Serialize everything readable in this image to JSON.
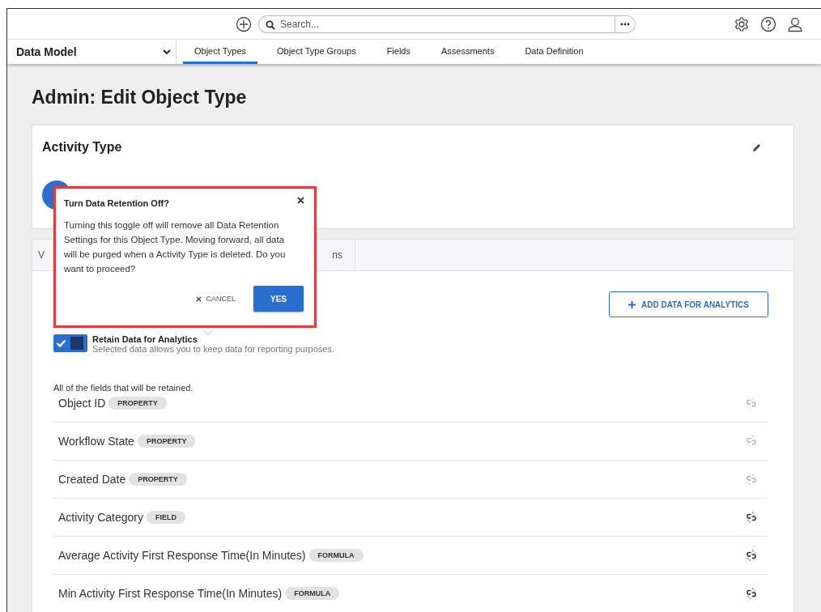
{
  "header": {
    "search": {
      "placeholder": "Search..."
    }
  },
  "nav": {
    "module": "Data Model",
    "tabs": [
      {
        "label": "Object Types",
        "selected": true
      },
      {
        "label": "Object Type Groups",
        "selected": false
      },
      {
        "label": "Fields",
        "selected": false
      },
      {
        "label": "Assessments",
        "selected": false
      },
      {
        "label": "Data Definition",
        "selected": false
      }
    ]
  },
  "page_title": "Admin: Edit Object Type",
  "card": {
    "title": "Activity Type"
  },
  "section_tabs": [
    {
      "label": "V"
    },
    {
      "label": "ns"
    }
  ],
  "popover": {
    "title": "Turn Data Retention Off?",
    "message": "Turning this toggle off will remove all Data Retention Settings for this Object Type. Moving forward, all data will be purged when a Activity Type is deleted. Do you want to proceed?",
    "cancel": "CANCEL",
    "confirm": "YES"
  },
  "add_button": "ADD DATA FOR ANALYTICS",
  "retention": {
    "on": true,
    "label": "Retain Data for Analytics",
    "description": "Selected data allows you to keep data for reporting purposes."
  },
  "fields_caption": "All of the fields that will be retained.",
  "fields": [
    {
      "name": "Object ID",
      "tag": "PROPERTY",
      "disabled": true
    },
    {
      "name": "Workflow State",
      "tag": "PROPERTY",
      "disabled": true
    },
    {
      "name": "Created Date",
      "tag": "PROPERTY",
      "disabled": true
    },
    {
      "name": "Activity Category",
      "tag": "FIELD",
      "disabled": false
    },
    {
      "name": "Average Activity First Response Time(In Minutes)",
      "tag": "FORMULA",
      "disabled": false
    },
    {
      "name": "Min Activity First Response Time(In Minutes)",
      "tag": "FORMULA",
      "disabled": false
    }
  ]
}
